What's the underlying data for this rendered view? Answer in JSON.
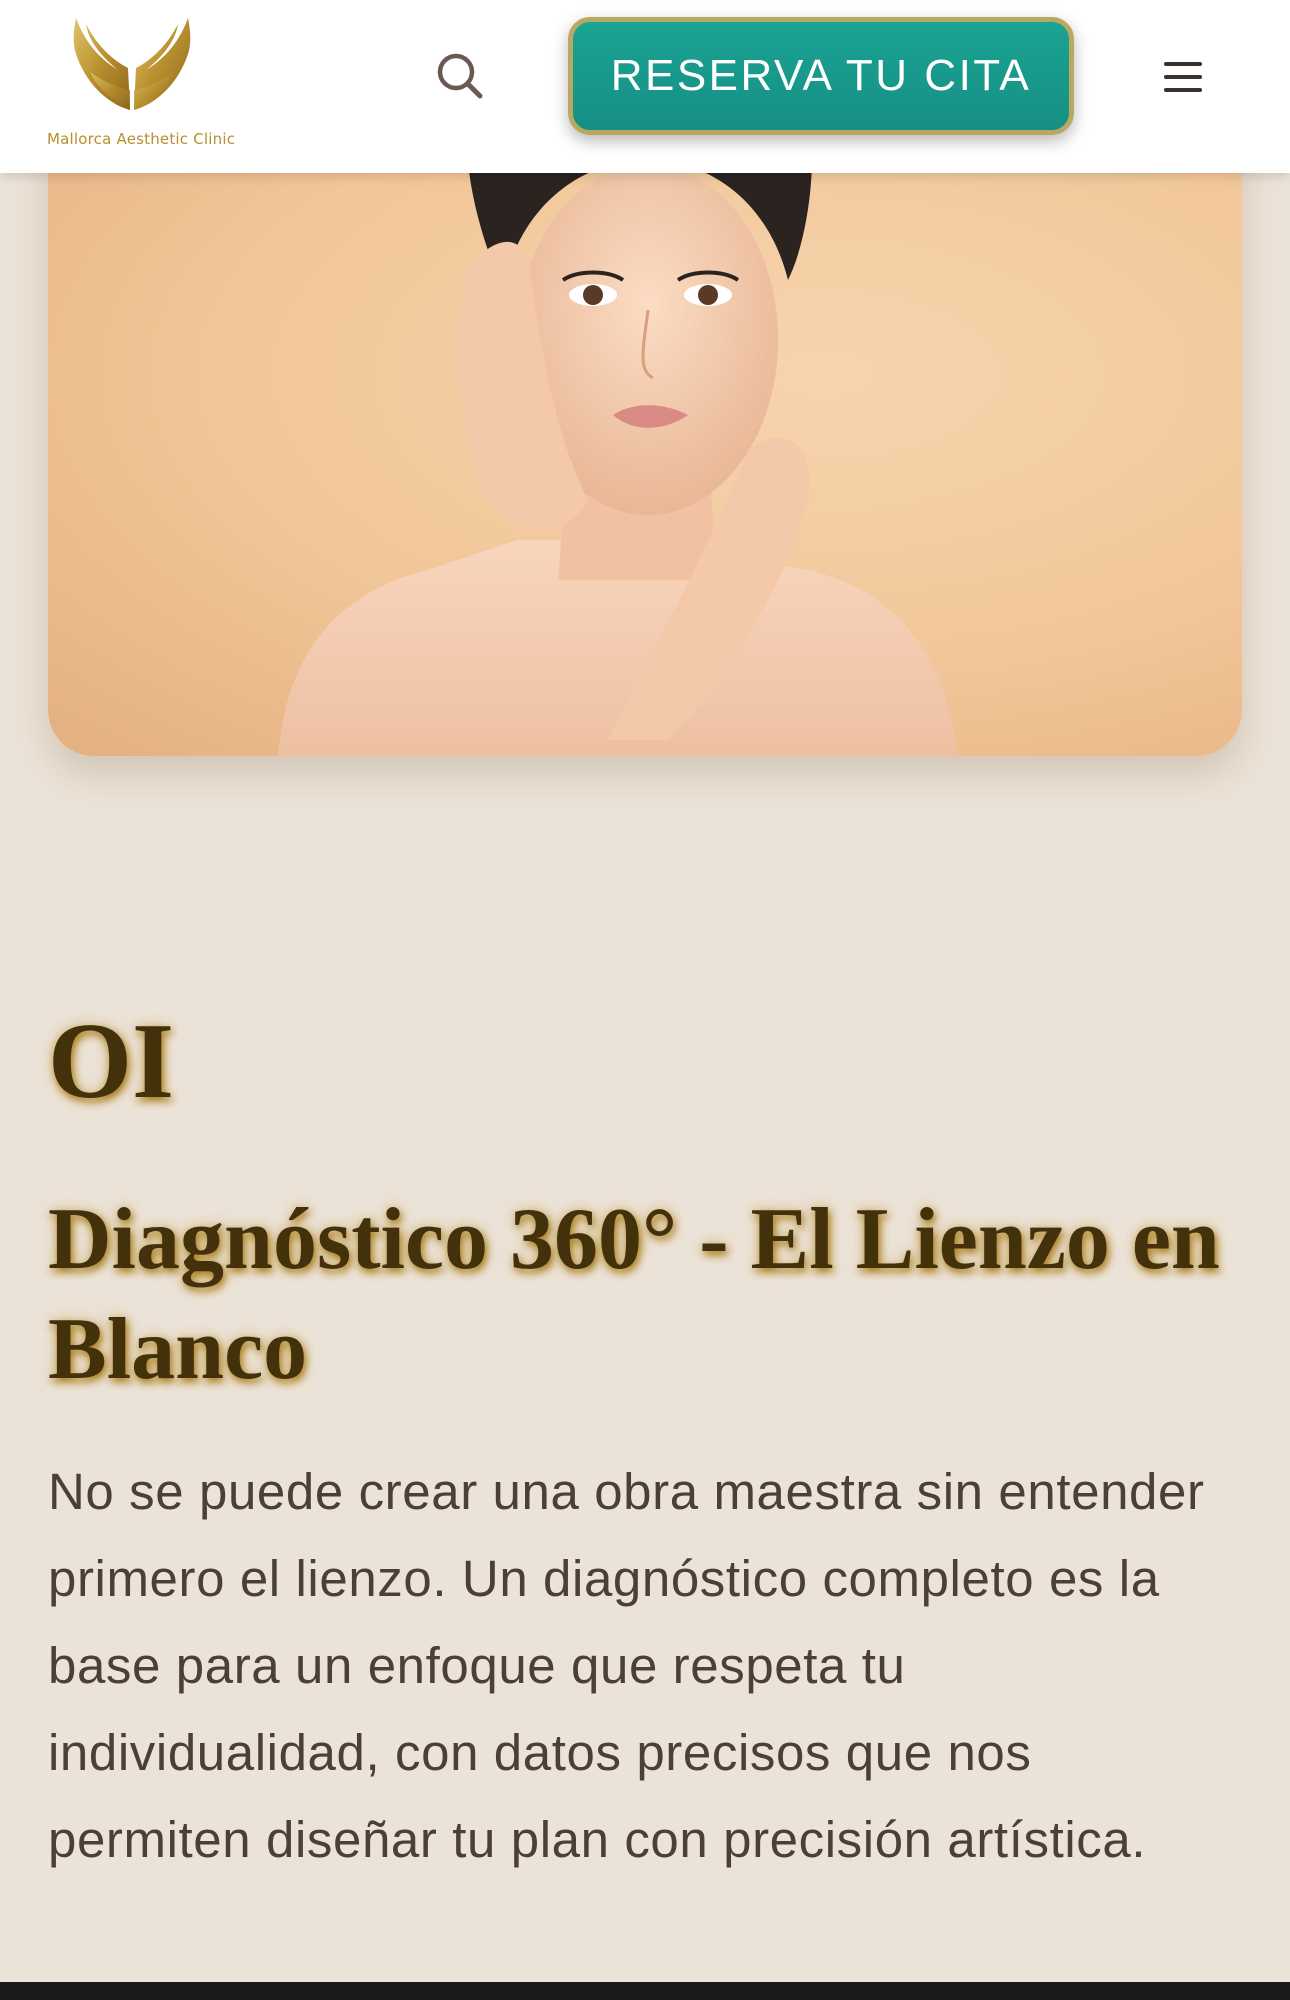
{
  "header": {
    "logo_text": "Mallorca Aesthetic Clinic",
    "cta_label": "RESERVA TU CITA",
    "search_icon": "search-icon",
    "menu_icon": "hamburger-menu-icon"
  },
  "hero": {
    "image": "portrait-woman-touching-face"
  },
  "section": {
    "number": "OI",
    "title": "Diagnóstico 360° - El Lienzo en Blanco",
    "body": "No se puede crear una obra maestra sin entender primero el lienzo. Un diagnóstico completo es la base para un enfoque que respeta tu individualidad, con datos precisos que nos permiten diseñar tu plan con precisión artística."
  },
  "colors": {
    "accent_teal": "#1aa394",
    "gold": "#b88f2e",
    "background": "#ece3d8",
    "heading": "#43310c",
    "text": "#4b3f38"
  }
}
